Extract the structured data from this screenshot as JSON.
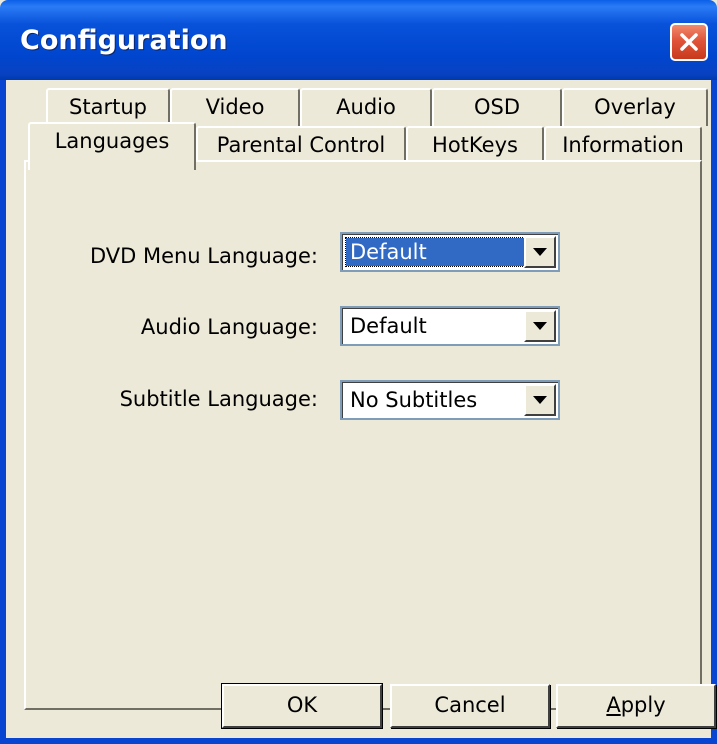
{
  "window": {
    "title": "Configuration"
  },
  "tabs": {
    "row1": [
      {
        "label": "Startup"
      },
      {
        "label": "Video"
      },
      {
        "label": "Audio"
      },
      {
        "label": "OSD"
      },
      {
        "label": "Overlay"
      }
    ],
    "row2": [
      {
        "label": "Languages",
        "active": true
      },
      {
        "label": "Parental Control"
      },
      {
        "label": "HotKeys"
      },
      {
        "label": "Information"
      }
    ]
  },
  "languages": {
    "dvd_menu": {
      "label": "DVD Menu Language:",
      "value": "Default"
    },
    "audio": {
      "label": "Audio Language:",
      "value": "Default"
    },
    "subtitle": {
      "label": "Subtitle Language:",
      "value": "No Subtitles"
    }
  },
  "buttons": {
    "ok": "OK",
    "cancel": "Cancel",
    "apply": "Apply"
  },
  "icons": {
    "close": "close-icon",
    "dropdown": "chevron-down-icon"
  },
  "colors": {
    "titlebar": "#0845D0",
    "dialog_bg": "#ECE9D8",
    "selection": "#316AC5",
    "close_button": "#E0553A"
  }
}
